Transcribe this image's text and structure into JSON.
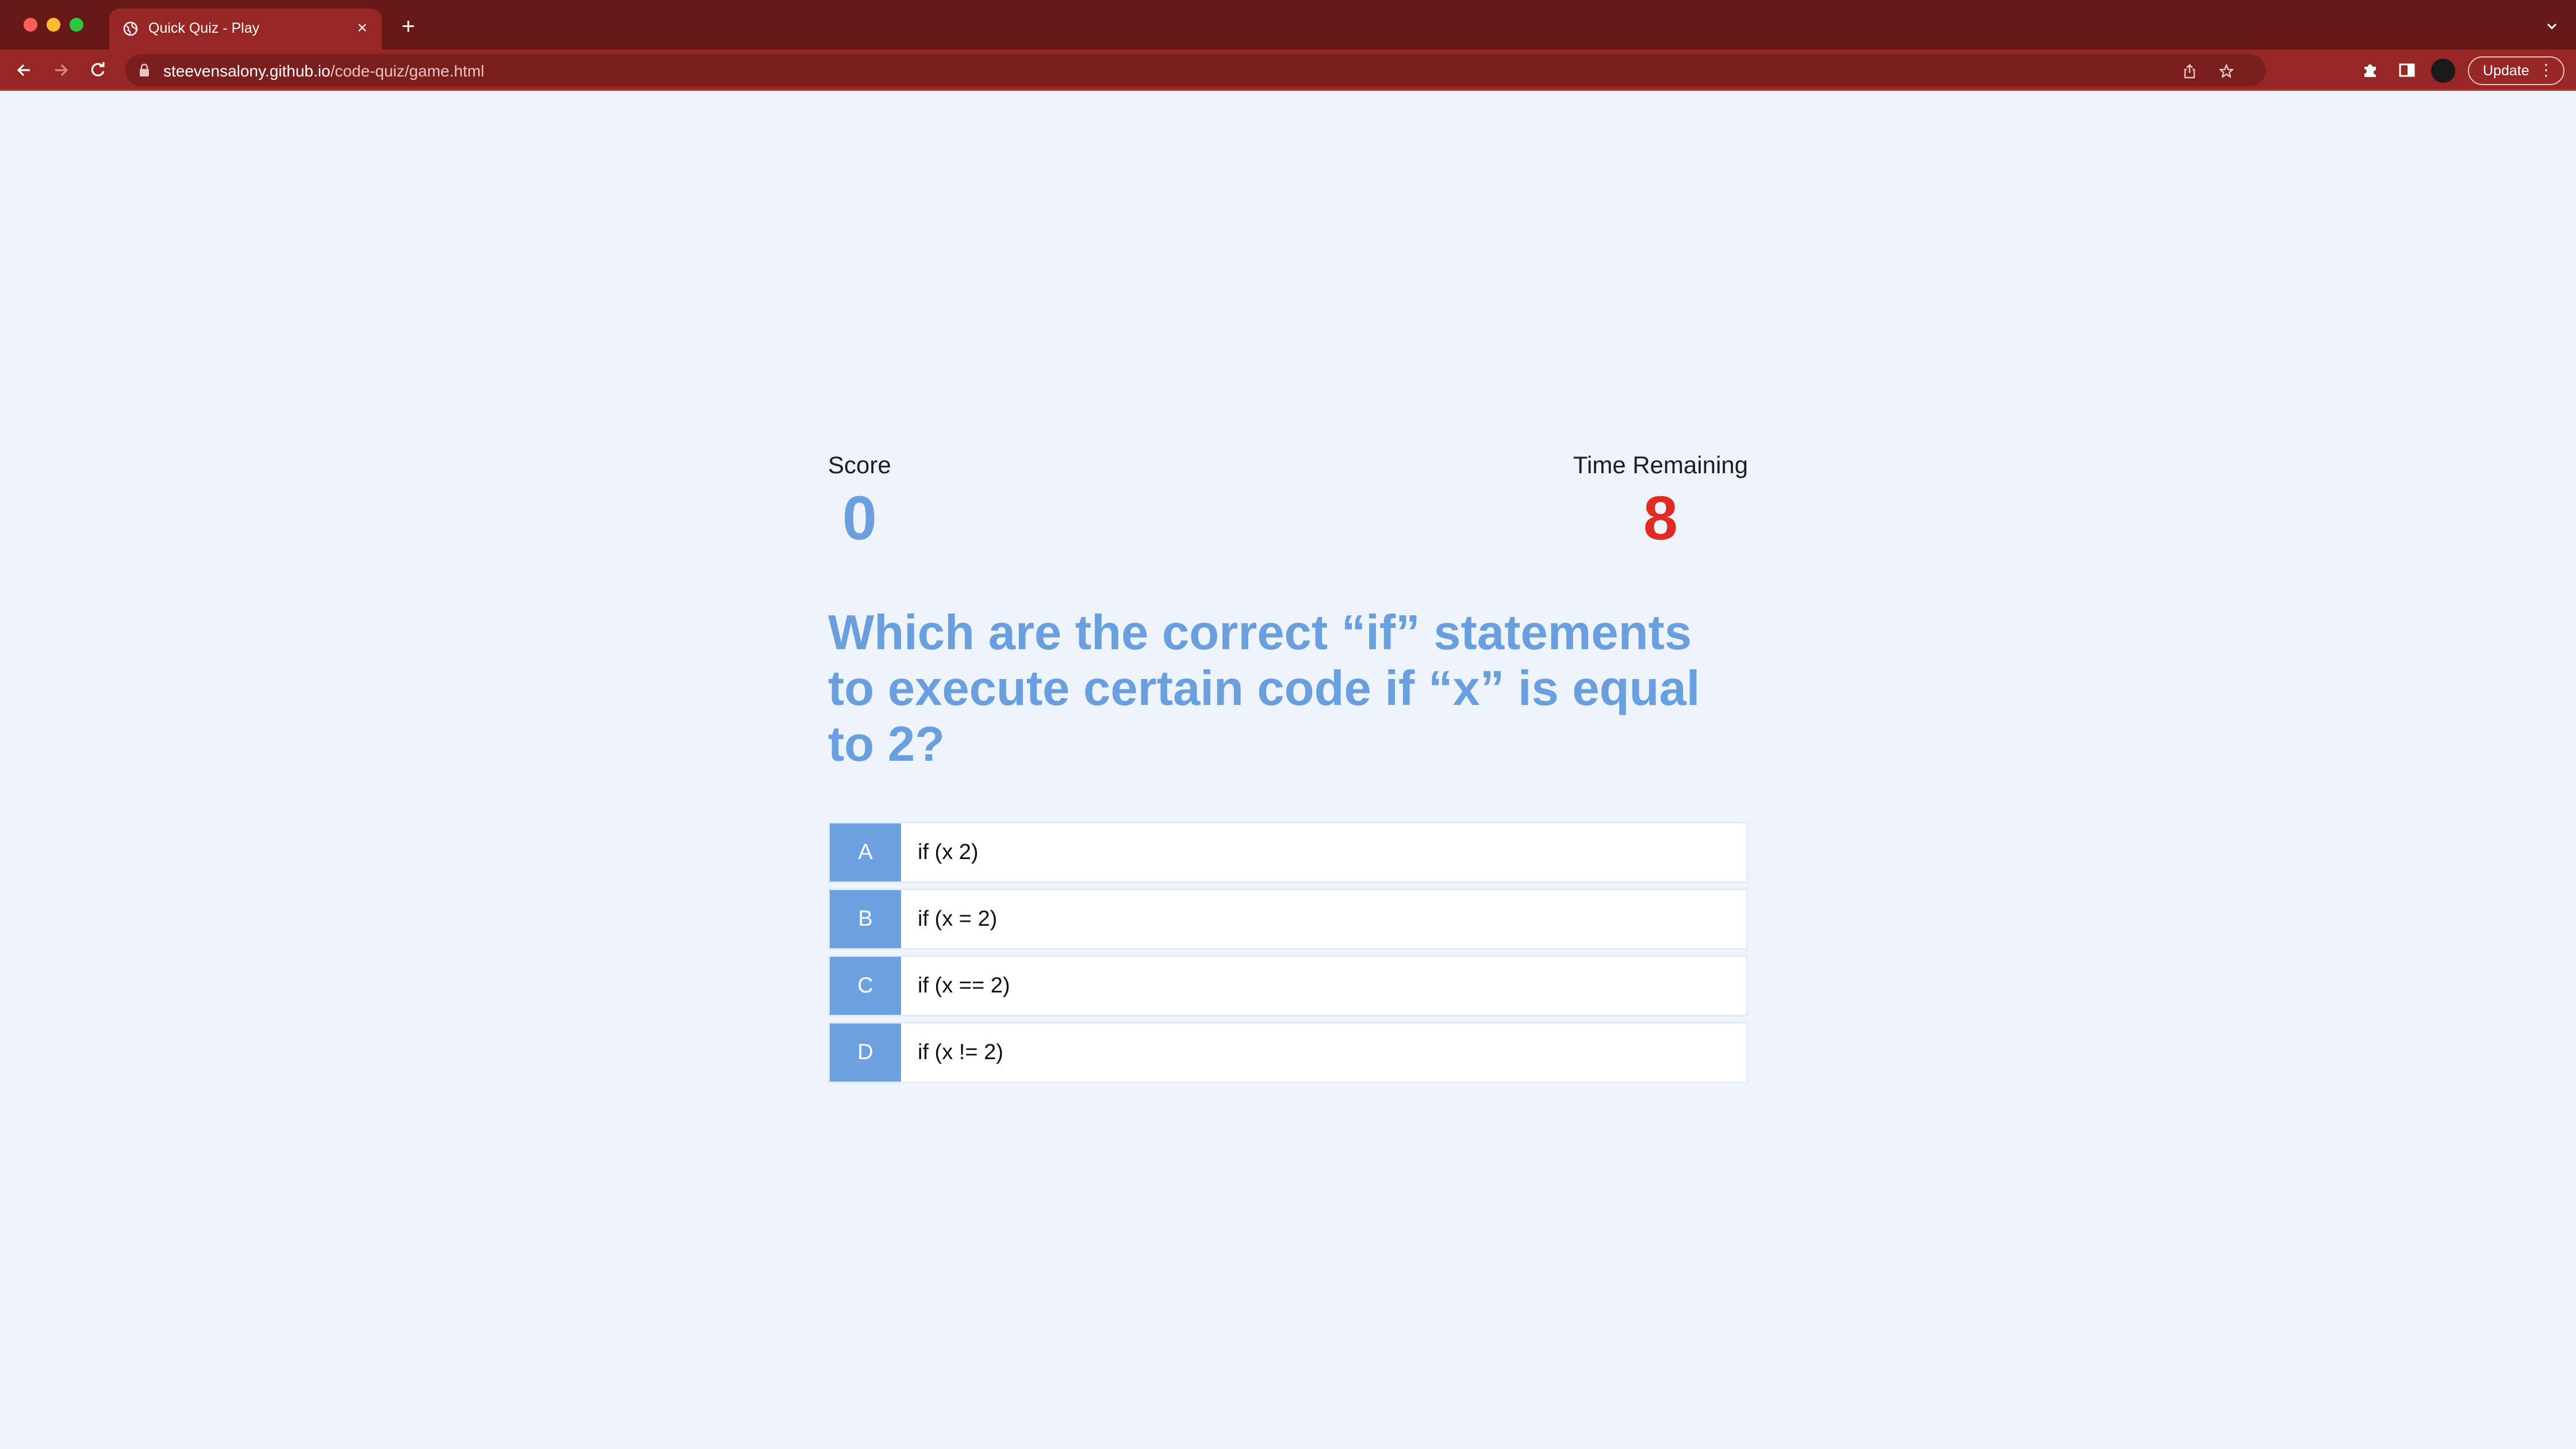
{
  "browser": {
    "tab_title": "Quick Quiz - Play",
    "url_host": "steevensalony.github.io",
    "url_path": "/code-quiz/game.html",
    "update_label": "Update",
    "colors": {
      "tabbar": "#671918",
      "toolbar": "#962724"
    },
    "icons": [
      "globe-icon",
      "close-icon",
      "plus-icon",
      "chevron-down-icon",
      "back-arrow-icon",
      "forward-arrow-icon",
      "reload-icon",
      "lock-icon",
      "share-icon",
      "star-icon",
      "puzzle-icon",
      "side-panel-icon",
      "kebab-menu-icon"
    ]
  },
  "hud": {
    "score_label": "Score",
    "score_value": "0",
    "time_label": "Time Remaining",
    "time_value": "8"
  },
  "question": {
    "text": "Which are the correct “if” statements to execute certain code if “x” is equal to 2?"
  },
  "choices": [
    {
      "prefix": "A",
      "text": "if (x 2)"
    },
    {
      "prefix": "B",
      "text": "if (x = 2)"
    },
    {
      "prefix": "C",
      "text": "if (x == 2)"
    },
    {
      "prefix": "D",
      "text": "if (x != 2)"
    }
  ],
  "colors": {
    "background": "#edf4fd",
    "accent_blue": "#6a9fdf",
    "timer_red": "#df2b23"
  }
}
